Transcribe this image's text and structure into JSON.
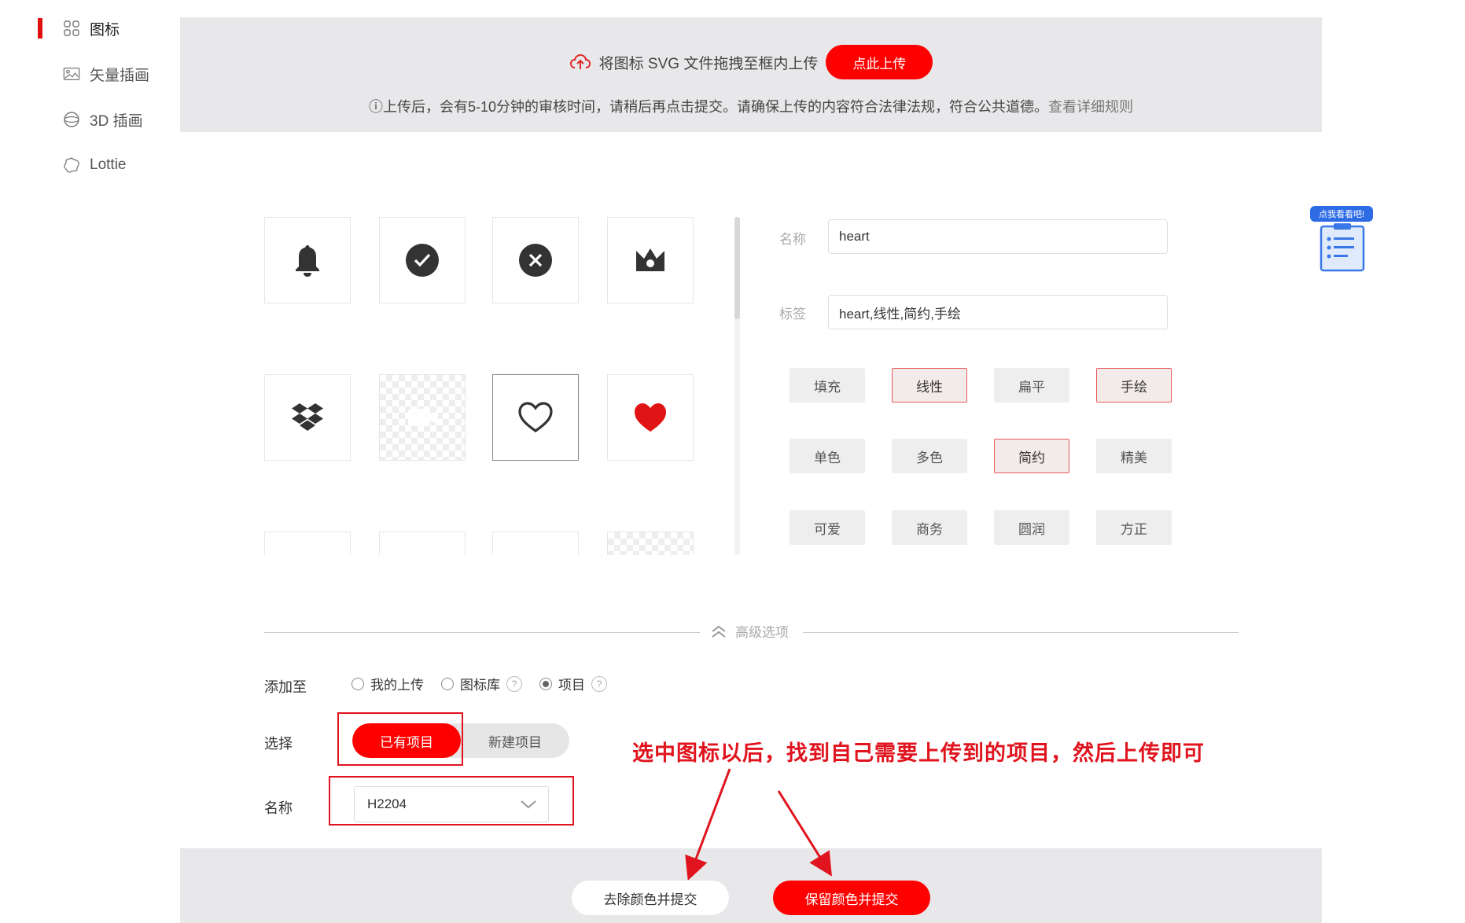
{
  "sidebar": {
    "items": [
      {
        "label": "图标",
        "icon": "grid-icon"
      },
      {
        "label": "矢量插画",
        "icon": "image-icon"
      },
      {
        "label": "3D 插画",
        "icon": "sphere-icon"
      },
      {
        "label": "Lottie",
        "icon": "lottie-icon"
      }
    ]
  },
  "upload": {
    "hint": "将图标 SVG 文件拖拽至框内上传",
    "button": "点此上传",
    "notice": "ⓘ上传后，会有5-10分钟的审核时间，请稍后再点击提交。请确保上传的内容符合法律法规，符合公共道德。",
    "rules_link": "查看详细规则"
  },
  "icons": [
    {
      "name": "bell-icon"
    },
    {
      "name": "check-circle-icon"
    },
    {
      "name": "close-circle-icon"
    },
    {
      "name": "crown-icon"
    },
    {
      "name": "dropbox-icon"
    },
    {
      "name": "placeholder-icon"
    },
    {
      "name": "heart-outline-icon",
      "selected": true
    },
    {
      "name": "heart-filled-icon"
    }
  ],
  "form": {
    "name_label": "名称",
    "name_value": "heart",
    "tags_label": "标签",
    "tags_value": "heart,线性,简约,手绘",
    "tags": [
      {
        "label": "填充",
        "on": false
      },
      {
        "label": "线性",
        "on": true
      },
      {
        "label": "扁平",
        "on": false
      },
      {
        "label": "手绘",
        "on": true
      },
      {
        "label": "单色",
        "on": false
      },
      {
        "label": "多色",
        "on": false
      },
      {
        "label": "简约",
        "on": true
      },
      {
        "label": "精美",
        "on": false
      },
      {
        "label": "可爱",
        "on": false
      },
      {
        "label": "商务",
        "on": false
      },
      {
        "label": "圆润",
        "on": false
      },
      {
        "label": "方正",
        "on": false
      }
    ]
  },
  "advanced": {
    "toggle_label": "高级选项",
    "add_to_label": "添加至",
    "options": [
      "我的上传",
      "图标库",
      "项目"
    ],
    "selected_option": "项目",
    "select_label": "选择",
    "existing_project": "已有项目",
    "new_project": "新建项目",
    "project_name_label": "名称",
    "project_name_value": "H2204"
  },
  "annotation": "选中图标以后，找到自己需要上传到的项目，然后上传即可",
  "footer": {
    "remove_color_submit": "去除颜色并提交",
    "keep_color_submit": "保留颜色并提交"
  },
  "float_widget": {
    "badge": "点我看看吧!"
  },
  "colors": {
    "accent": "#ff0000",
    "annotation": "#e0141e",
    "upload_bg": "#e8e8ea"
  }
}
